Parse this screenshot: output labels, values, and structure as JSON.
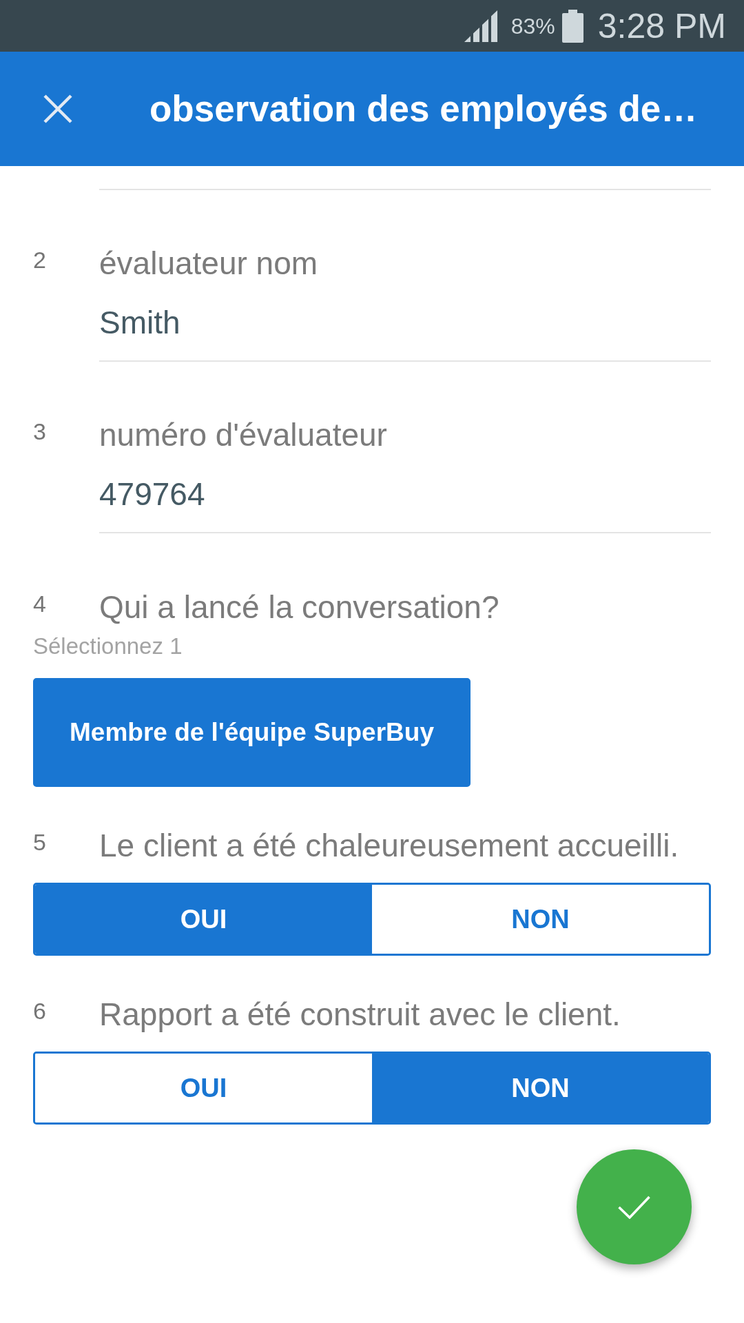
{
  "status_bar": {
    "battery": "83%",
    "time": "3:28 PM"
  },
  "header": {
    "title": "observation des employés de…"
  },
  "questions": [
    {
      "kind": "text",
      "number": "2",
      "label": "évaluateur nom",
      "value": "Smith"
    },
    {
      "kind": "text",
      "number": "3",
      "label": "numéro d'évaluateur",
      "value": "479764"
    },
    {
      "kind": "choice",
      "number": "4",
      "label": "Qui a lancé la conversation?",
      "hint": "Sélectionnez 1",
      "options": [
        {
          "label": "Membre de l'équipe SuperBuy",
          "selected": true
        }
      ]
    },
    {
      "kind": "segmented",
      "number": "5",
      "label": "Le client a été chaleureusement accueilli.",
      "options": [
        {
          "label": "OUI",
          "selected": true
        },
        {
          "label": "NON",
          "selected": false
        }
      ]
    },
    {
      "kind": "segmented",
      "number": "6",
      "label": "Rapport a été construit avec le client.",
      "options": [
        {
          "label": "OUI",
          "selected": false
        },
        {
          "label": "NON",
          "selected": true
        }
      ]
    }
  ]
}
